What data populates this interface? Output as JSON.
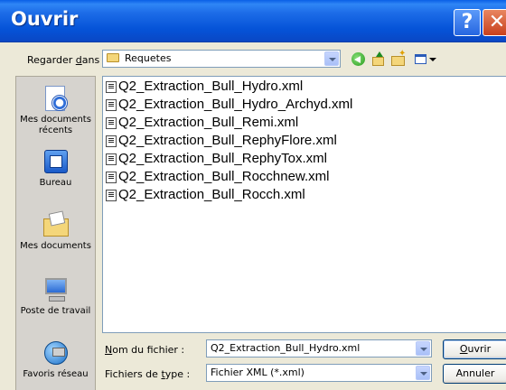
{
  "window": {
    "title": "Ouvrir",
    "help_glyph": "?",
    "close_glyph": "✕"
  },
  "lookin": {
    "label_pre": "Regarder ",
    "label_accel": "d",
    "label_post": "ans :",
    "value": "Requetes"
  },
  "toolbar": {
    "icons": [
      "back-icon",
      "up-folder-icon",
      "new-folder-icon",
      "views-menu-icon"
    ]
  },
  "places": [
    {
      "label": "Mes documents\nrécents",
      "icon": "recent-documents-icon"
    },
    {
      "label": "Bureau",
      "icon": "desktop-icon"
    },
    {
      "label": "Mes documents",
      "icon": "my-documents-icon"
    },
    {
      "label": "Poste de travail",
      "icon": "my-computer-icon"
    },
    {
      "label": "Favoris réseau",
      "icon": "network-places-icon"
    }
  ],
  "files": [
    "Q2_Extraction_Bull_Hydro.xml",
    "Q2_Extraction_Bull_Hydro_Archyd.xml",
    "Q2_Extraction_Bull_Remi.xml",
    "Q2_Extraction_Bull_RephyFlore.xml",
    "Q2_Extraction_Bull_RephyTox.xml",
    "Q2_Extraction_Bull_Rocchnew.xml",
    "Q2_Extraction_Bull_Rocch.xml"
  ],
  "filename": {
    "label_pre": "",
    "label_accel": "N",
    "label_post": "om du fichier :",
    "value": "Q2_Extraction_Bull_Hydro.xml"
  },
  "filetype": {
    "label_pre": "Fichiers de ",
    "label_accel": "t",
    "label_post": "ype :",
    "value": "Fichier XML (*.xml)"
  },
  "buttons": {
    "open_accel": "O",
    "open_post": "uvrir",
    "cancel": "Annuler"
  }
}
